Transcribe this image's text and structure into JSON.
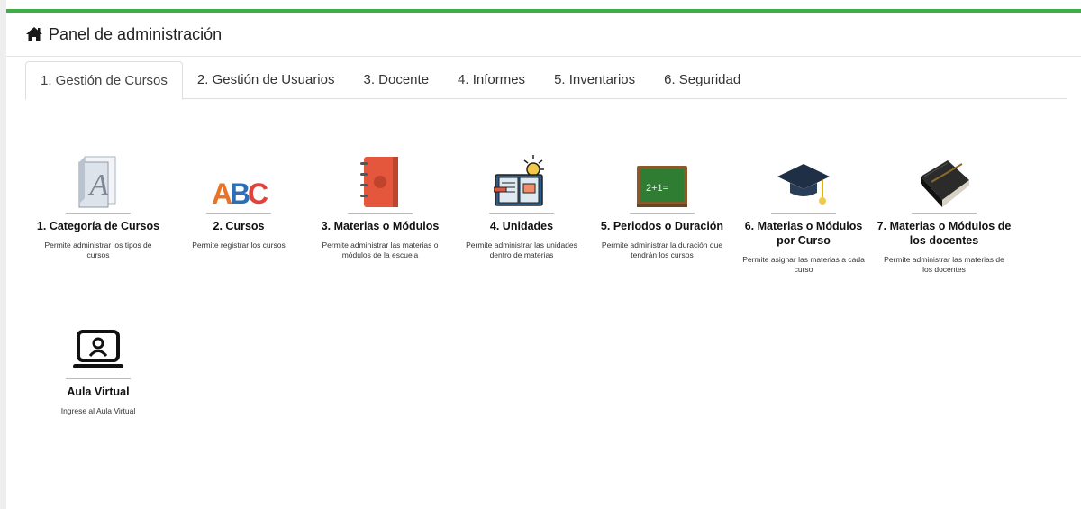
{
  "header": {
    "title": "Panel de administración"
  },
  "tabs": [
    {
      "label": "1. Gestión de Cursos",
      "active": true
    },
    {
      "label": "2. Gestión de Usuarios",
      "active": false
    },
    {
      "label": "3. Docente",
      "active": false
    },
    {
      "label": "4. Informes",
      "active": false
    },
    {
      "label": "5. Inventarios",
      "active": false
    },
    {
      "label": "6. Seguridad",
      "active": false
    }
  ],
  "tiles": [
    {
      "title": "1. Categoría de Cursos",
      "desc": "Permite administrar los tipos de cursos",
      "icon": "document-font-icon"
    },
    {
      "title": "2. Cursos",
      "desc": "Permite registrar los cursos",
      "icon": "abc-icon"
    },
    {
      "title": "3. Materias o Módulos",
      "desc": "Permite administrar las materias o módulos de la escuela",
      "icon": "notebook-icon"
    },
    {
      "title": "4. Unidades",
      "desc": "Permite administrar las unidades dentro de materias",
      "icon": "book-idea-icon"
    },
    {
      "title": "5. Periodos o Duración",
      "desc": "Permite administrar la duración que tendrán los cursos",
      "icon": "chalkboard-icon",
      "icon_text": "2+1="
    },
    {
      "title": "6. Materias o Módulos por Curso",
      "desc": "Permite asignar las materias a cada curso",
      "icon": "graduation-cap-icon"
    },
    {
      "title": "7. Materias o Módulos de los docentes",
      "desc": "Permite administrar las materias de los docentes",
      "icon": "black-notebook-icon"
    },
    {
      "title": "Aula Virtual",
      "desc": "Ingrese al Aula Virtual",
      "icon": "laptop-user-icon"
    }
  ],
  "colors": {
    "accent": "#3fae49",
    "border": "#dedede"
  }
}
